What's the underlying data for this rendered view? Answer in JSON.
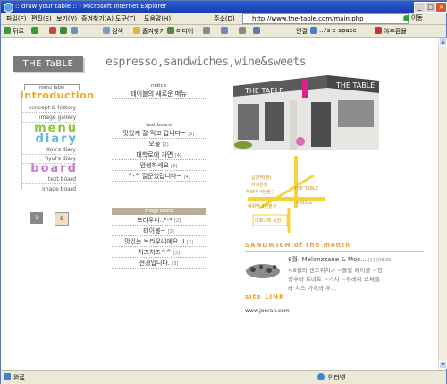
{
  "window": {
    "title": ":: draw your table :: - Microsoft Internet Explorer",
    "min": "_",
    "max": "□",
    "close": "×"
  },
  "menubar": {
    "items": [
      "파일(F)",
      "편집(E)",
      "보기(V)",
      "즐겨찾기(A)",
      "도구(T)",
      "도움말(H)"
    ],
    "address_label": "주소(D)",
    "address": "http://www.the-table.com/main.php",
    "go": "이동"
  },
  "toolbar": {
    "back": "뒤로",
    "search": "검색",
    "favorites": "즐겨찾기",
    "media": "미디어",
    "links_label": "연결",
    "link1": "...'s e-space-",
    "link2": "야후환율"
  },
  "status": {
    "left": "완료",
    "zone": "인터넷"
  },
  "site": {
    "logo": "THE TaBLE",
    "slogan": "espresso,sandwiches,wine&sweets",
    "menu_tab": "menu table",
    "menu": {
      "introduction": "introduction",
      "concept": "concept & history",
      "gallery": "image gallery",
      "menu_word": "menu",
      "diary_word": "diary",
      "koo": "Koo's diary",
      "ryul": "Ryul's diary",
      "board_word": "board",
      "text_board": "text board",
      "image_board": "image board"
    },
    "pager": [
      "1",
      "8"
    ],
    "notice": {
      "head": "notice",
      "item": "테이블의 새로운 메뉴"
    },
    "text_board": {
      "head": "text board",
      "items": [
        {
          "t": "맛있게 잘 먹고 갑니다~",
          "c": "[5]"
        },
        {
          "t": "오늘",
          "c": "[2]"
        },
        {
          "t": "대학로에 가면",
          "c": "[4]"
        },
        {
          "t": "안녕하세요",
          "c": "[3]"
        },
        {
          "t": "^-^ 질문있답니다~",
          "c": "[4]"
        }
      ]
    },
    "image_board": {
      "head": "image board",
      "items": [
        {
          "t": "브라우니..*-*",
          "c": "[2]"
        },
        {
          "t": "테이블~",
          "c": "[3]"
        },
        {
          "t": "맛있는 브라우니에요 :)",
          "c": "[3]"
        },
        {
          "t": "치즈치즈^^",
          "c": "[3]"
        },
        {
          "t": "전경입니다.",
          "c": "[3]"
        }
      ]
    },
    "building_signs": [
      "THE TABLE",
      "THE TABLE"
    ],
    "map_labels": [
      "갈관역(출)",
      "하나은행",
      "혜화역 4번출구",
      "혜화역 3번출구",
      "THE TABLE",
      "혜화초교",
      "마로니에 공원"
    ],
    "sandwich": {
      "head": "SANDWICH of the month",
      "title": "8월- Melanzzane & Moz...",
      "count": "[1]",
      "date": "[08.09]",
      "desc1": "<8월의 샌드위치> ~돌말 베이글 ~양",
      "desc2": "상추와 토마토 ~가지 ~후레쉬 모짜렐",
      "desc3": "라 치즈 가지와 후..."
    },
    "link": {
      "head": "site LINK",
      "url": "www.jooran.com"
    }
  },
  "colors": {
    "introduction": "#f3a71b",
    "menu_word": "#8ac53c",
    "diary_word": "#5ab6e6",
    "board_word": "#c87ad0",
    "section": "#e2a234",
    "map_road": "#f6d33a",
    "logo_bg": "#7b7b7b"
  }
}
